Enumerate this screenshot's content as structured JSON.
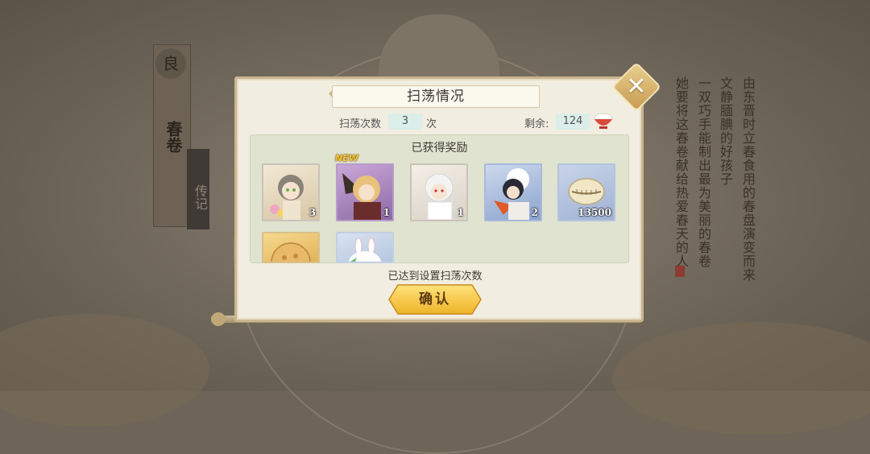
{
  "background": {
    "banner_char": "良",
    "banner_title": "春卷",
    "side_tab": "传记",
    "poem_columns": [
      "由东晋时立春食用的春盘演变而来",
      "文静腼腆的好孩子",
      "一双巧手能制出最为美丽的春卷",
      "她要将这春卷献给热爱春天的人"
    ]
  },
  "dialog": {
    "title": "扫荡情况",
    "sweep_label": "扫荡次数",
    "sweep_count": "3",
    "sweep_unit": "次",
    "remain_label": "剩余:",
    "remain_count": "124",
    "rewards_header": "已获得奖励",
    "new_badge": "NEW",
    "rewards": [
      {
        "name": "春卷 character card",
        "icon": "portrait-grey-hair-girl",
        "count": "3"
      },
      {
        "name": "character card",
        "icon": "portrait-blonde-feather",
        "count": "1"
      },
      {
        "name": "character card",
        "icon": "portrait-white-hair",
        "count": "1"
      },
      {
        "name": "character card",
        "icon": "portrait-dark-hair-fan",
        "count": "2"
      },
      {
        "name": "shell currency",
        "icon": "cowrie-shell",
        "count": "13500"
      },
      {
        "name": "item",
        "icon": "golden-cookie",
        "count": ""
      },
      {
        "name": "item",
        "icon": "white-bunny-bun",
        "count": ""
      }
    ],
    "status": "已达到设置扫荡次数",
    "confirm": "确认"
  },
  "colors": {
    "dialog_bg": "#f1ede0",
    "panel_bg": "#dfe3cf",
    "count_box_bg": "#dbeee9",
    "confirm_gold": "#f2c43c"
  }
}
